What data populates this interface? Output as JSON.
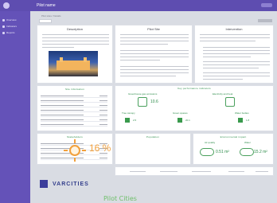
{
  "app": {
    "title": "Pilot name"
  },
  "sidebar": {
    "items": [
      {
        "label": "Overview"
      },
      {
        "label": "Indicators"
      },
      {
        "label": "Reports"
      }
    ]
  },
  "breadcrumb": "Pilot sites / Details",
  "cards": {
    "photo": "Description",
    "story": "Pilot Site",
    "intervention": "Intervention"
  },
  "table": {
    "title": "Site information"
  },
  "kpi": {
    "title": "Key performance indicators",
    "section1": "Greenhouse gas emissions",
    "section2": "Electricity and heat",
    "val1": "10.6",
    "lbl1": "Tree canopy",
    "lbl2": "Green spaces",
    "lbl3": "Water bodies",
    "val2": "2.5",
    "val3": "20.1",
    "val4": "1.8"
  },
  "stats": {
    "title": "Population",
    "pct": "16 %"
  },
  "env": {
    "title": "Environmental impact",
    "sub1": "Air quality",
    "sub2": "Water",
    "val1": "0.51 m²",
    "val2": "15.2 m²"
  },
  "people": {
    "title": "Stakeholders"
  },
  "footer": {
    "brand": "VARCITIES",
    "headline": "Pilot Cities"
  },
  "colors": {
    "purple": "#5e4db0",
    "green": "#2d8c4a",
    "orange": "#f2a03b",
    "navy": "#333e8c"
  },
  "icons": [
    "logo-icon",
    "dashboard-icon",
    "chart-icon",
    "document-icon",
    "sun-icon",
    "cloud-icon",
    "tree-icon",
    "people-icon"
  ]
}
